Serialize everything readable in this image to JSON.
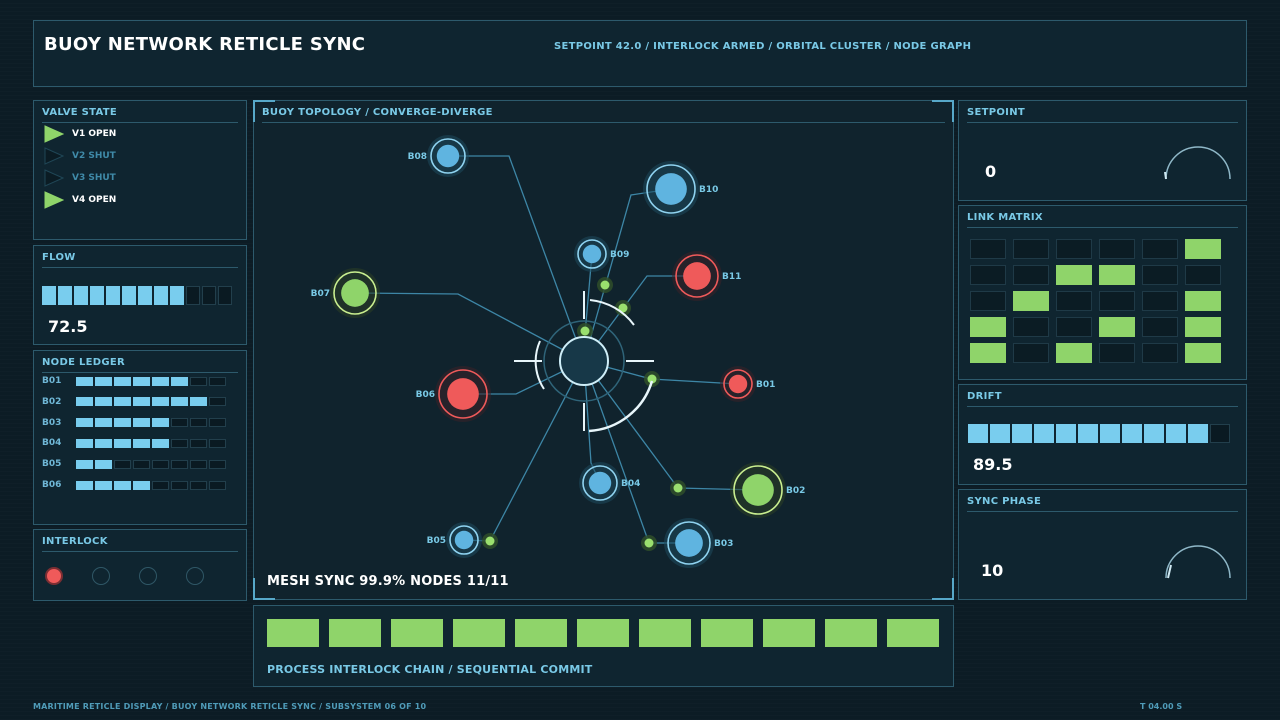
{
  "header": {
    "title": "BUOY NETWORK RETICLE SYNC",
    "status": "SETPOINT 42.0 / INTERLOCK ARMED / ORBITAL CLUSTER / NODE GRAPH"
  },
  "valve_state": {
    "title": "VALVE STATE",
    "items": [
      {
        "label": "V1 OPEN",
        "open": true
      },
      {
        "label": "V2 SHUT",
        "open": false
      },
      {
        "label": "V3 SHUT",
        "open": false
      },
      {
        "label": "V4 OPEN",
        "open": true
      }
    ]
  },
  "flow": {
    "title": "FLOW",
    "value": "72.5",
    "segments_total": 12,
    "segments_on": 9
  },
  "node_ledger": {
    "title": "NODE LEDGER",
    "segments_total": 8,
    "rows": [
      {
        "label": "B01",
        "level": 6
      },
      {
        "label": "B02",
        "level": 7
      },
      {
        "label": "B03",
        "level": 5
      },
      {
        "label": "B04",
        "level": 5
      },
      {
        "label": "B05",
        "level": 2
      },
      {
        "label": "B06",
        "level": 4
      }
    ]
  },
  "interlock": {
    "title": "INTERLOCK",
    "lamps": [
      true,
      false,
      false,
      false
    ]
  },
  "topology": {
    "title": "BUOY TOPOLOGY / CONVERGE-DIVERGE",
    "mesh_status": "MESH SYNC  99.9%   NODES 11/11",
    "nodes": [
      {
        "label": "B01",
        "status": "alert"
      },
      {
        "label": "B02",
        "status": "ok"
      },
      {
        "label": "B03",
        "status": "nominal"
      },
      {
        "label": "B04",
        "status": "nominal"
      },
      {
        "label": "B05",
        "status": "nominal"
      },
      {
        "label": "B06",
        "status": "alert"
      },
      {
        "label": "B07",
        "status": "ok"
      },
      {
        "label": "B08",
        "status": "nominal"
      },
      {
        "label": "B09",
        "status": "nominal"
      },
      {
        "label": "B10",
        "status": "nominal"
      },
      {
        "label": "B11",
        "status": "alert"
      }
    ]
  },
  "chain": {
    "label": "PROCESS INTERLOCK CHAIN / SEQUENTIAL COMMIT",
    "blocks": 11
  },
  "setpoint": {
    "title": "SETPOINT",
    "value": "0"
  },
  "link_matrix": {
    "title": "LINK MATRIX",
    "rows": [
      [
        0,
        0,
        0,
        0,
        0,
        1
      ],
      [
        0,
        0,
        1,
        1,
        0,
        0
      ],
      [
        0,
        1,
        0,
        0,
        0,
        1
      ],
      [
        1,
        0,
        0,
        1,
        0,
        1
      ],
      [
        1,
        0,
        1,
        0,
        0,
        1
      ]
    ]
  },
  "drift": {
    "title": "DRIFT",
    "value": "89.5",
    "segments_total": 12,
    "segments_on": 11
  },
  "sync_phase": {
    "title": "SYNC PHASE",
    "value": "10"
  },
  "footer": {
    "left": "MARITIME RETICLE DISPLAY / BUOY NETWORK RETICLE SYNC / SUBSYSTEM 06 OF 10",
    "right": "T 04.00 S"
  },
  "colors": {
    "accent": "#79cdee",
    "ok": "#8fd46a",
    "alert": "#ef5a5a",
    "background": "#0c1c25"
  }
}
